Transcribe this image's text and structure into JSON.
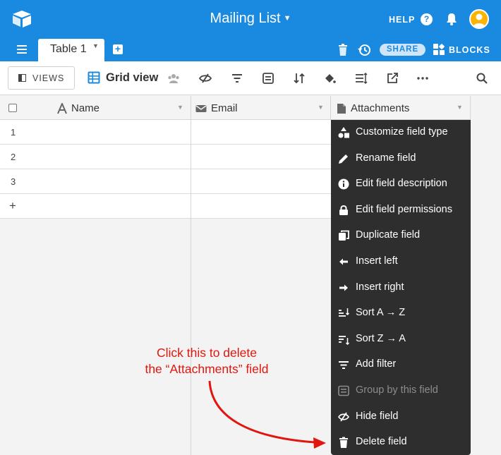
{
  "header": {
    "title": "Mailing List",
    "help_label": "HELP",
    "help_glyph": "?",
    "share_label": "SHARE",
    "blocks_label": "BLOCKS",
    "accent_color": "#1a8ae0",
    "avatar_color": "#fcb400"
  },
  "tabs": {
    "active_label": "Table 1",
    "add_glyph": "+"
  },
  "toolbar": {
    "views_label": "VIEWS",
    "view_name": "Grid view",
    "icons": [
      "hide-fields-icon",
      "filter-icon",
      "group-icon",
      "sort-icon",
      "color-icon",
      "row-height-icon",
      "share-view-icon",
      "more-icon",
      "search-icon"
    ]
  },
  "grid": {
    "columns": [
      {
        "label": "Name",
        "icon": "text-field-icon"
      },
      {
        "label": "Email",
        "icon": "email-field-icon"
      },
      {
        "label": "Attachments",
        "icon": "attachment-field-icon"
      }
    ],
    "rows": [
      "1",
      "2",
      "3"
    ],
    "add_row_glyph": "+"
  },
  "context_menu": {
    "items": [
      {
        "label": "Customize field type",
        "icon": "shapes-icon",
        "enabled": true
      },
      {
        "label": "Rename field",
        "icon": "pencil-icon",
        "enabled": true
      },
      {
        "label": "Edit field description",
        "icon": "info-icon",
        "enabled": true
      },
      {
        "label": "Edit field permissions",
        "icon": "lock-icon",
        "enabled": true
      },
      {
        "label": "Duplicate field",
        "icon": "duplicate-icon",
        "enabled": true
      },
      {
        "label": "Insert left",
        "icon": "arrow-left-icon",
        "enabled": true
      },
      {
        "label": "Insert right",
        "icon": "arrow-right-icon",
        "enabled": true
      },
      {
        "label": "Sort A → Z",
        "icon": "sort-asc-icon",
        "enabled": true
      },
      {
        "label": "Sort Z → A",
        "icon": "sort-desc-icon",
        "enabled": true
      },
      {
        "label": "Add filter",
        "icon": "filter-icon",
        "enabled": true
      },
      {
        "label": "Group by this field",
        "icon": "group-icon",
        "enabled": false
      },
      {
        "label": "Hide field",
        "icon": "hide-icon",
        "enabled": true
      },
      {
        "label": "Delete field",
        "icon": "trash-icon",
        "enabled": true
      }
    ]
  },
  "annotation": {
    "line1": "Click this to delete",
    "line2": "the “Attachments” field",
    "color": "#e0160f"
  }
}
